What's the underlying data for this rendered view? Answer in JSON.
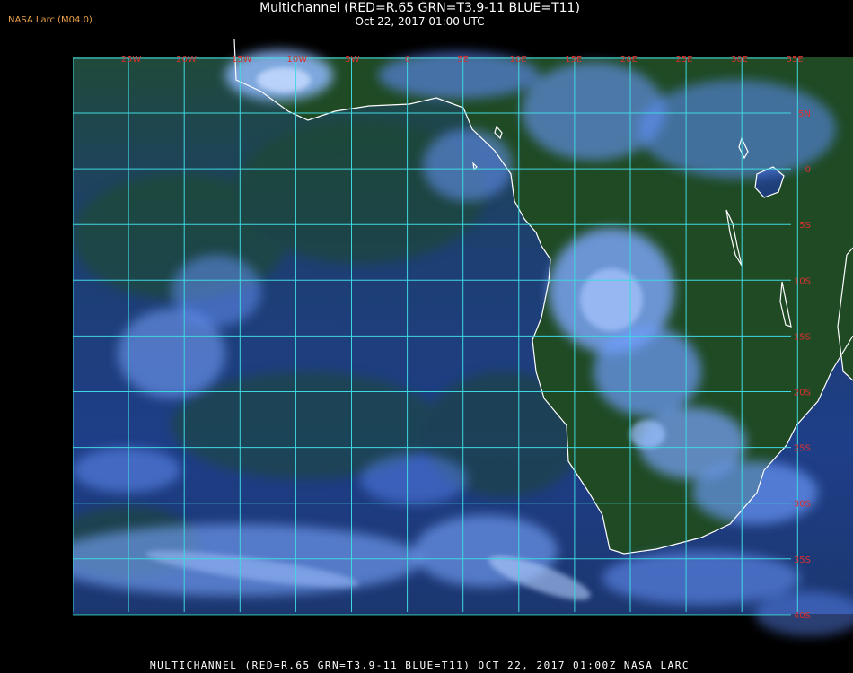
{
  "header": {
    "producer_tag": "NASA Larc (M04.0)",
    "title": "Multichannel (RED=R.65 GRN=T3.9-11 BLUE=T11)",
    "subtitle": "Oct 22, 2017 01:00 UTC"
  },
  "map": {
    "lon_labels": [
      "25W",
      "20W",
      "15W",
      "10W",
      "5W",
      "0",
      "5E",
      "10E",
      "15E",
      "20E",
      "25E",
      "30E",
      "35E"
    ],
    "lat_labels": [
      "5N",
      "0",
      "5S",
      "10S",
      "15S",
      "20S",
      "25S",
      "30S",
      "35S",
      "40S"
    ],
    "colors": {
      "grid": "#40d8e0",
      "coast": "#ffffff",
      "label": "#d83030",
      "ocean": "#1e3f86",
      "land": "#1e4a22",
      "cloud": "#6aa0ff"
    }
  },
  "footer": {
    "text": "MULTICHANNEL (RED=R.65 GRN=T3.9-11 BLUE=T11) OCT 22, 2017 01:00Z  NASA LARC"
  }
}
